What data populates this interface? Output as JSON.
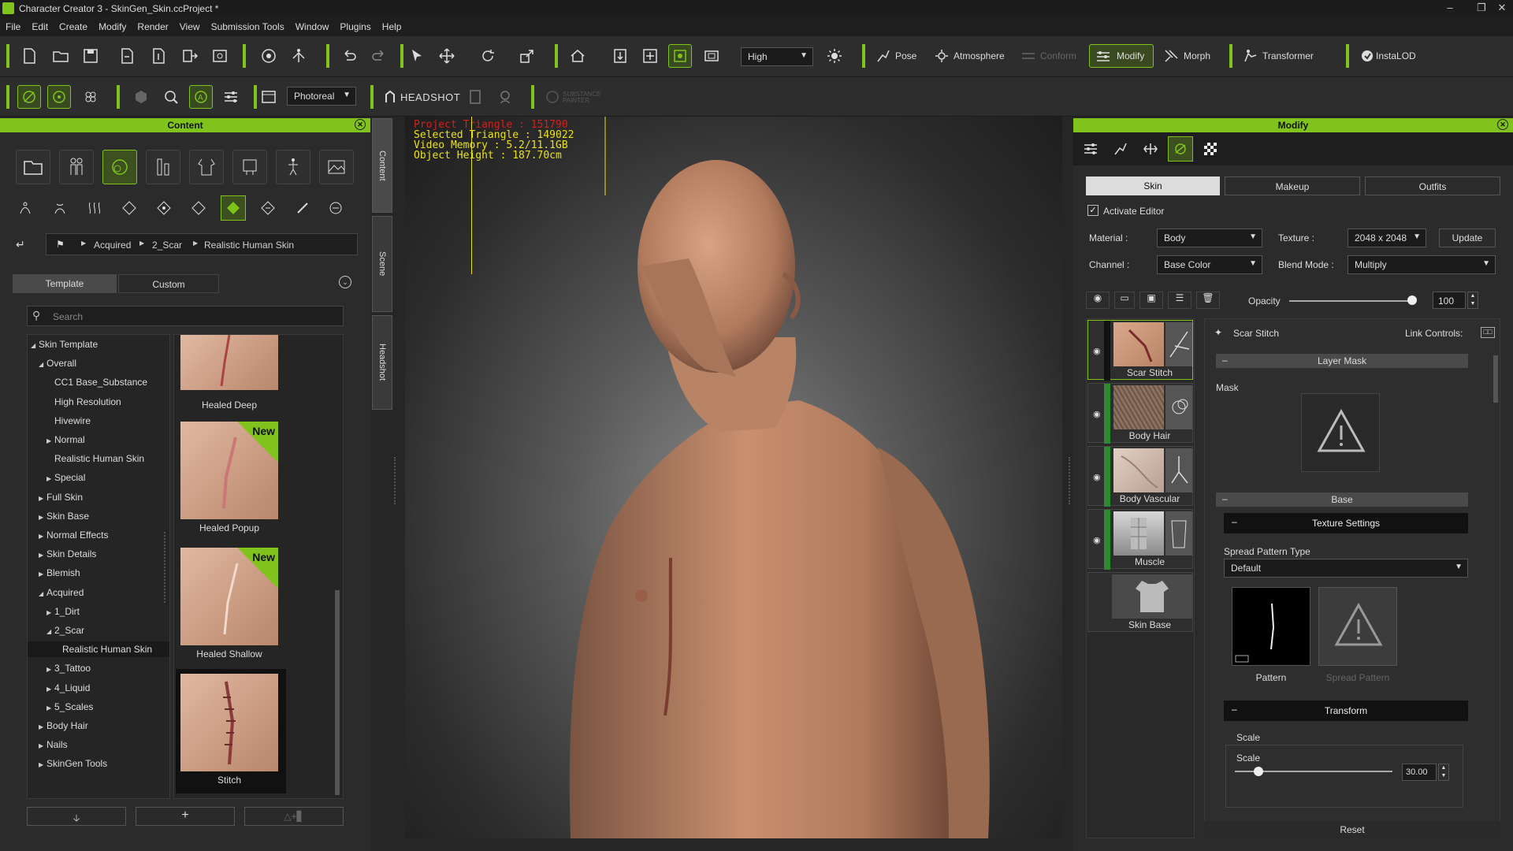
{
  "window": {
    "title": "Character Creator 3 - SkinGen_Skin.ccProject *"
  },
  "menu": [
    "File",
    "Edit",
    "Create",
    "Modify",
    "Render",
    "View",
    "Submission Tools",
    "Window",
    "Plugins",
    "Help"
  ],
  "toolbar": {
    "quality": "High",
    "pose": "Pose",
    "atmosphere": "Atmosphere",
    "conform": "Conform",
    "modify": "Modify",
    "morph": "Morph",
    "transformer": "Transformer",
    "instalod": "InstaLOD",
    "render_mode": "Photoreal",
    "headshot": "HEADSHOT",
    "substance": "SUBSTANCE PAINTER"
  },
  "content_panel": {
    "title": "Content",
    "breadcrumb": [
      "Acquired",
      "2_Scar",
      "Realistic Human Skin"
    ],
    "tabs": [
      "Template",
      "Custom"
    ],
    "search_placeholder": "Search",
    "tree": [
      {
        "label": "Skin Template",
        "level": 0,
        "arrow": "open"
      },
      {
        "label": "Overall",
        "level": 1,
        "arrow": "open"
      },
      {
        "label": "CC1 Base_Substance",
        "level": 2,
        "arrow": ""
      },
      {
        "label": "High Resolution",
        "level": 2,
        "arrow": ""
      },
      {
        "label": "Hivewire",
        "level": 2,
        "arrow": ""
      },
      {
        "label": "Normal",
        "level": 2,
        "arrow": "closed"
      },
      {
        "label": "Realistic Human Skin",
        "level": 2,
        "arrow": ""
      },
      {
        "label": "Special",
        "level": 2,
        "arrow": "closed"
      },
      {
        "label": "Full Skin",
        "level": 1,
        "arrow": "closed"
      },
      {
        "label": "Skin Base",
        "level": 1,
        "arrow": "closed"
      },
      {
        "label": "Normal Effects",
        "level": 1,
        "arrow": "closed"
      },
      {
        "label": "Skin Details",
        "level": 1,
        "arrow": "closed"
      },
      {
        "label": "Blemish",
        "level": 1,
        "arrow": "closed"
      },
      {
        "label": "Acquired",
        "level": 1,
        "arrow": "open"
      },
      {
        "label": "1_Dirt",
        "level": 2,
        "arrow": "closed"
      },
      {
        "label": "2_Scar",
        "level": 2,
        "arrow": "open"
      },
      {
        "label": "Realistic Human Skin",
        "level": 3,
        "arrow": "",
        "selected": true
      },
      {
        "label": "3_Tattoo",
        "level": 2,
        "arrow": "closed"
      },
      {
        "label": "4_Liquid",
        "level": 2,
        "arrow": "closed"
      },
      {
        "label": "5_Scales",
        "level": 2,
        "arrow": "closed"
      },
      {
        "label": "Body Hair",
        "level": 1,
        "arrow": "closed"
      },
      {
        "label": "Nails",
        "level": 1,
        "arrow": "closed"
      },
      {
        "label": "SkinGen Tools",
        "level": 1,
        "arrow": "closed"
      }
    ],
    "thumbnails": [
      {
        "label": "Healed Deep",
        "new": false
      },
      {
        "label": "Healed Popup",
        "new": true
      },
      {
        "label": "Healed Shallow",
        "new": true
      },
      {
        "label": "Stitch",
        "new": false
      }
    ],
    "new_badge": "New"
  },
  "side_tabs": [
    "Content",
    "Scene",
    "Headshot"
  ],
  "viewport": {
    "stats": {
      "project_triangle": "Project Triangle : 151790",
      "selected_triangle": "Selected Triangle : 149022",
      "video_memory": "Video Memory : 5.2/11.1GB",
      "object_height": "Object Height : 187.70cm"
    }
  },
  "modify_panel": {
    "title": "Modify",
    "tabs": [
      "Skin",
      "Makeup",
      "Outfits"
    ],
    "activate_editor": "Activate Editor",
    "material_label": "Material :",
    "material_value": "Body",
    "texture_label": "Texture :",
    "texture_value": "2048 x 2048",
    "update": "Update",
    "channel_label": "Channel :",
    "channel_value": "Base Color",
    "blend_label": "Blend Mode :",
    "blend_value": "Multiply",
    "opacity_label": "Opacity",
    "opacity_value": "100",
    "layers": [
      "Scar Stitch",
      "Body Hair",
      "Body Vascular",
      "Muscle",
      "Skin Base"
    ],
    "selected_layer": "Scar Stitch",
    "link_controls": "Link Controls:",
    "layer_mask": "Layer Mask",
    "mask_label": "Mask",
    "base": "Base",
    "texture_settings": "Texture Settings",
    "spread_pattern_type": "Spread Pattern Type",
    "spread_default": "Default",
    "pattern": "Pattern",
    "spread_pattern": "Spread Pattern",
    "transform": "Transform",
    "scale_group": "Scale",
    "scale_label": "Scale",
    "scale_value": "30.00",
    "reset": "Reset"
  },
  "colors": {
    "accent": "#7fc31c",
    "panel": "#2b2b2b",
    "stats_red": "#d22020",
    "stats_yellow": "#e8e020"
  }
}
